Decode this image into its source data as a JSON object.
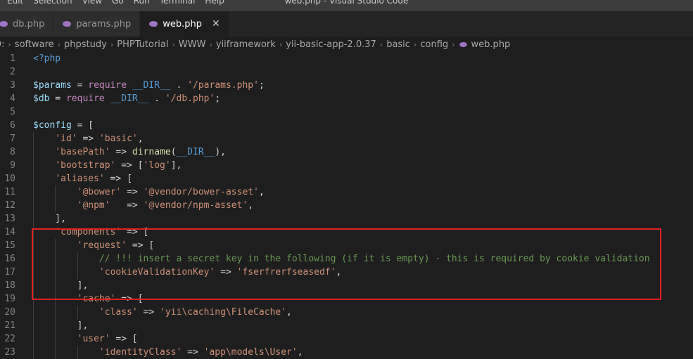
{
  "menu": [
    "Edit",
    "Selection",
    "View",
    "Go",
    "Run",
    "Terminal",
    "Help"
  ],
  "window_title": "web.php - Visual Studio Code",
  "tabs": [
    {
      "label": "db.php",
      "active": false
    },
    {
      "label": "params.php",
      "active": false
    },
    {
      "label": "web.php",
      "active": true
    }
  ],
  "tab_close_glyph": "✕",
  "breadcrumb": [
    "D:",
    "software",
    "phpstudy",
    "PHPTutorial",
    "WWW",
    "yiiframework",
    "yii-basic-app-2.0.37",
    "basic",
    "config",
    "web.php"
  ],
  "colors": {
    "editor_bg": "#1e1e1e",
    "keyword": "#c586c0",
    "string": "#ce9178",
    "variable": "#9cdcfe",
    "comment": "#6a9955",
    "annotation_box": "#e01f1f",
    "php_icon": "#a074c4"
  },
  "code_lines": [
    {
      "n": "1",
      "segs": [
        [
          "kw-tag",
          "<?php"
        ]
      ]
    },
    {
      "n": "2",
      "segs": []
    },
    {
      "n": "3",
      "segs": [
        [
          "var",
          "$params"
        ],
        [
          "op",
          " = "
        ],
        [
          "kw",
          "require"
        ],
        [
          "op",
          " "
        ],
        [
          "const",
          "__DIR__"
        ],
        [
          "op",
          " . "
        ],
        [
          "str",
          "'/params.php'"
        ],
        [
          "op",
          ";"
        ]
      ]
    },
    {
      "n": "4",
      "segs": [
        [
          "var",
          "$db"
        ],
        [
          "op",
          " = "
        ],
        [
          "kw",
          "require"
        ],
        [
          "op",
          " "
        ],
        [
          "const",
          "__DIR__"
        ],
        [
          "op",
          " . "
        ],
        [
          "str",
          "'/db.php'"
        ],
        [
          "op",
          ";"
        ]
      ]
    },
    {
      "n": "5",
      "segs": []
    },
    {
      "n": "6",
      "segs": [
        [
          "var",
          "$config"
        ],
        [
          "op",
          " = ["
        ]
      ]
    },
    {
      "n": "7",
      "segs": [
        [
          "op",
          "    "
        ],
        [
          "str",
          "'id'"
        ],
        [
          "op",
          " => "
        ],
        [
          "str",
          "'basic'"
        ],
        [
          "op",
          ","
        ]
      ]
    },
    {
      "n": "8",
      "segs": [
        [
          "op",
          "    "
        ],
        [
          "str",
          "'basePath'"
        ],
        [
          "op",
          " => "
        ],
        [
          "fn",
          "dirname"
        ],
        [
          "op",
          "("
        ],
        [
          "const",
          "__DIR__"
        ],
        [
          "op",
          "),"
        ]
      ]
    },
    {
      "n": "9",
      "segs": [
        [
          "op",
          "    "
        ],
        [
          "str",
          "'bootstrap'"
        ],
        [
          "op",
          " => ["
        ],
        [
          "str",
          "'log'"
        ],
        [
          "op",
          "],"
        ]
      ]
    },
    {
      "n": "10",
      "segs": [
        [
          "op",
          "    "
        ],
        [
          "str",
          "'aliases'"
        ],
        [
          "op",
          " => ["
        ]
      ]
    },
    {
      "n": "11",
      "segs": [
        [
          "op",
          "        "
        ],
        [
          "str",
          "'@bower'"
        ],
        [
          "op",
          " => "
        ],
        [
          "str",
          "'@vendor/bower-asset'"
        ],
        [
          "op",
          ","
        ]
      ]
    },
    {
      "n": "12",
      "segs": [
        [
          "op",
          "        "
        ],
        [
          "str",
          "'@npm'"
        ],
        [
          "op",
          "   => "
        ],
        [
          "str",
          "'@vendor/npm-asset'"
        ],
        [
          "op",
          ","
        ]
      ]
    },
    {
      "n": "13",
      "segs": [
        [
          "op",
          "    ],"
        ]
      ]
    },
    {
      "n": "14",
      "segs": [
        [
          "op",
          "    "
        ],
        [
          "str",
          "'components'"
        ],
        [
          "op",
          " => ["
        ]
      ]
    },
    {
      "n": "15",
      "segs": [
        [
          "op",
          "        "
        ],
        [
          "str",
          "'request'"
        ],
        [
          "op",
          " => ["
        ]
      ]
    },
    {
      "n": "16",
      "segs": [
        [
          "op",
          "            "
        ],
        [
          "comment",
          "// !!! insert a secret key in the following (if it is empty) - this is required by cookie validation"
        ]
      ]
    },
    {
      "n": "17",
      "segs": [
        [
          "op",
          "            "
        ],
        [
          "str",
          "'cookieValidationKey'"
        ],
        [
          "op",
          " => "
        ],
        [
          "str",
          "'fserfrerfseasedf'"
        ],
        [
          "op",
          ","
        ]
      ]
    },
    {
      "n": "18",
      "segs": [
        [
          "op",
          "        ],"
        ]
      ]
    },
    {
      "n": "19",
      "segs": [
        [
          "op",
          "        "
        ],
        [
          "str",
          "'cache'"
        ],
        [
          "op",
          " => ["
        ]
      ]
    },
    {
      "n": "20",
      "segs": [
        [
          "op",
          "            "
        ],
        [
          "str",
          "'class'"
        ],
        [
          "op",
          " => "
        ],
        [
          "str",
          "'yii\\caching\\FileCache'"
        ],
        [
          "op",
          ","
        ]
      ]
    },
    {
      "n": "21",
      "segs": [
        [
          "op",
          "        ],"
        ]
      ]
    },
    {
      "n": "22",
      "segs": [
        [
          "op",
          "        "
        ],
        [
          "str",
          "'user'"
        ],
        [
          "op",
          " => ["
        ]
      ]
    },
    {
      "n": "23",
      "segs": [
        [
          "op",
          "            "
        ],
        [
          "str",
          "'identityClass'"
        ],
        [
          "op",
          " => "
        ],
        [
          "str",
          "'app\\models\\User'"
        ],
        [
          "op",
          ","
        ]
      ]
    }
  ]
}
